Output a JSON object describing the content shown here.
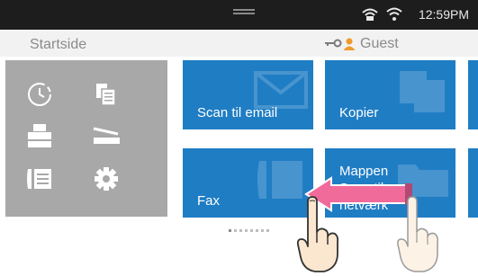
{
  "status_bar": {
    "time": "12:59PM",
    "icons": [
      "pull-down-handle",
      "network-icon",
      "wifi-icon"
    ]
  },
  "header": {
    "title": "Startside",
    "user_icon": "key-user-icon",
    "user": "Guest"
  },
  "shortcuts": [
    {
      "name": "history-clock-icon"
    },
    {
      "name": "documents-icon"
    },
    {
      "name": "printer-icon"
    },
    {
      "name": "scanner-icon"
    },
    {
      "name": "fax-phone-icon"
    },
    {
      "name": "settings-gear-icon"
    }
  ],
  "tiles": [
    {
      "label": "Scan til email"
    },
    {
      "label": "Kopier"
    },
    {
      "label": "Fax"
    },
    {
      "label": "Mappen\nScan til\nnetværk"
    }
  ],
  "colors": {
    "status_bar": "#1d1d1d",
    "tile": "#1f7dc4",
    "side_panel": "#a8a8a8",
    "arrow": "#f06a9a"
  },
  "gesture": "swipe-left"
}
